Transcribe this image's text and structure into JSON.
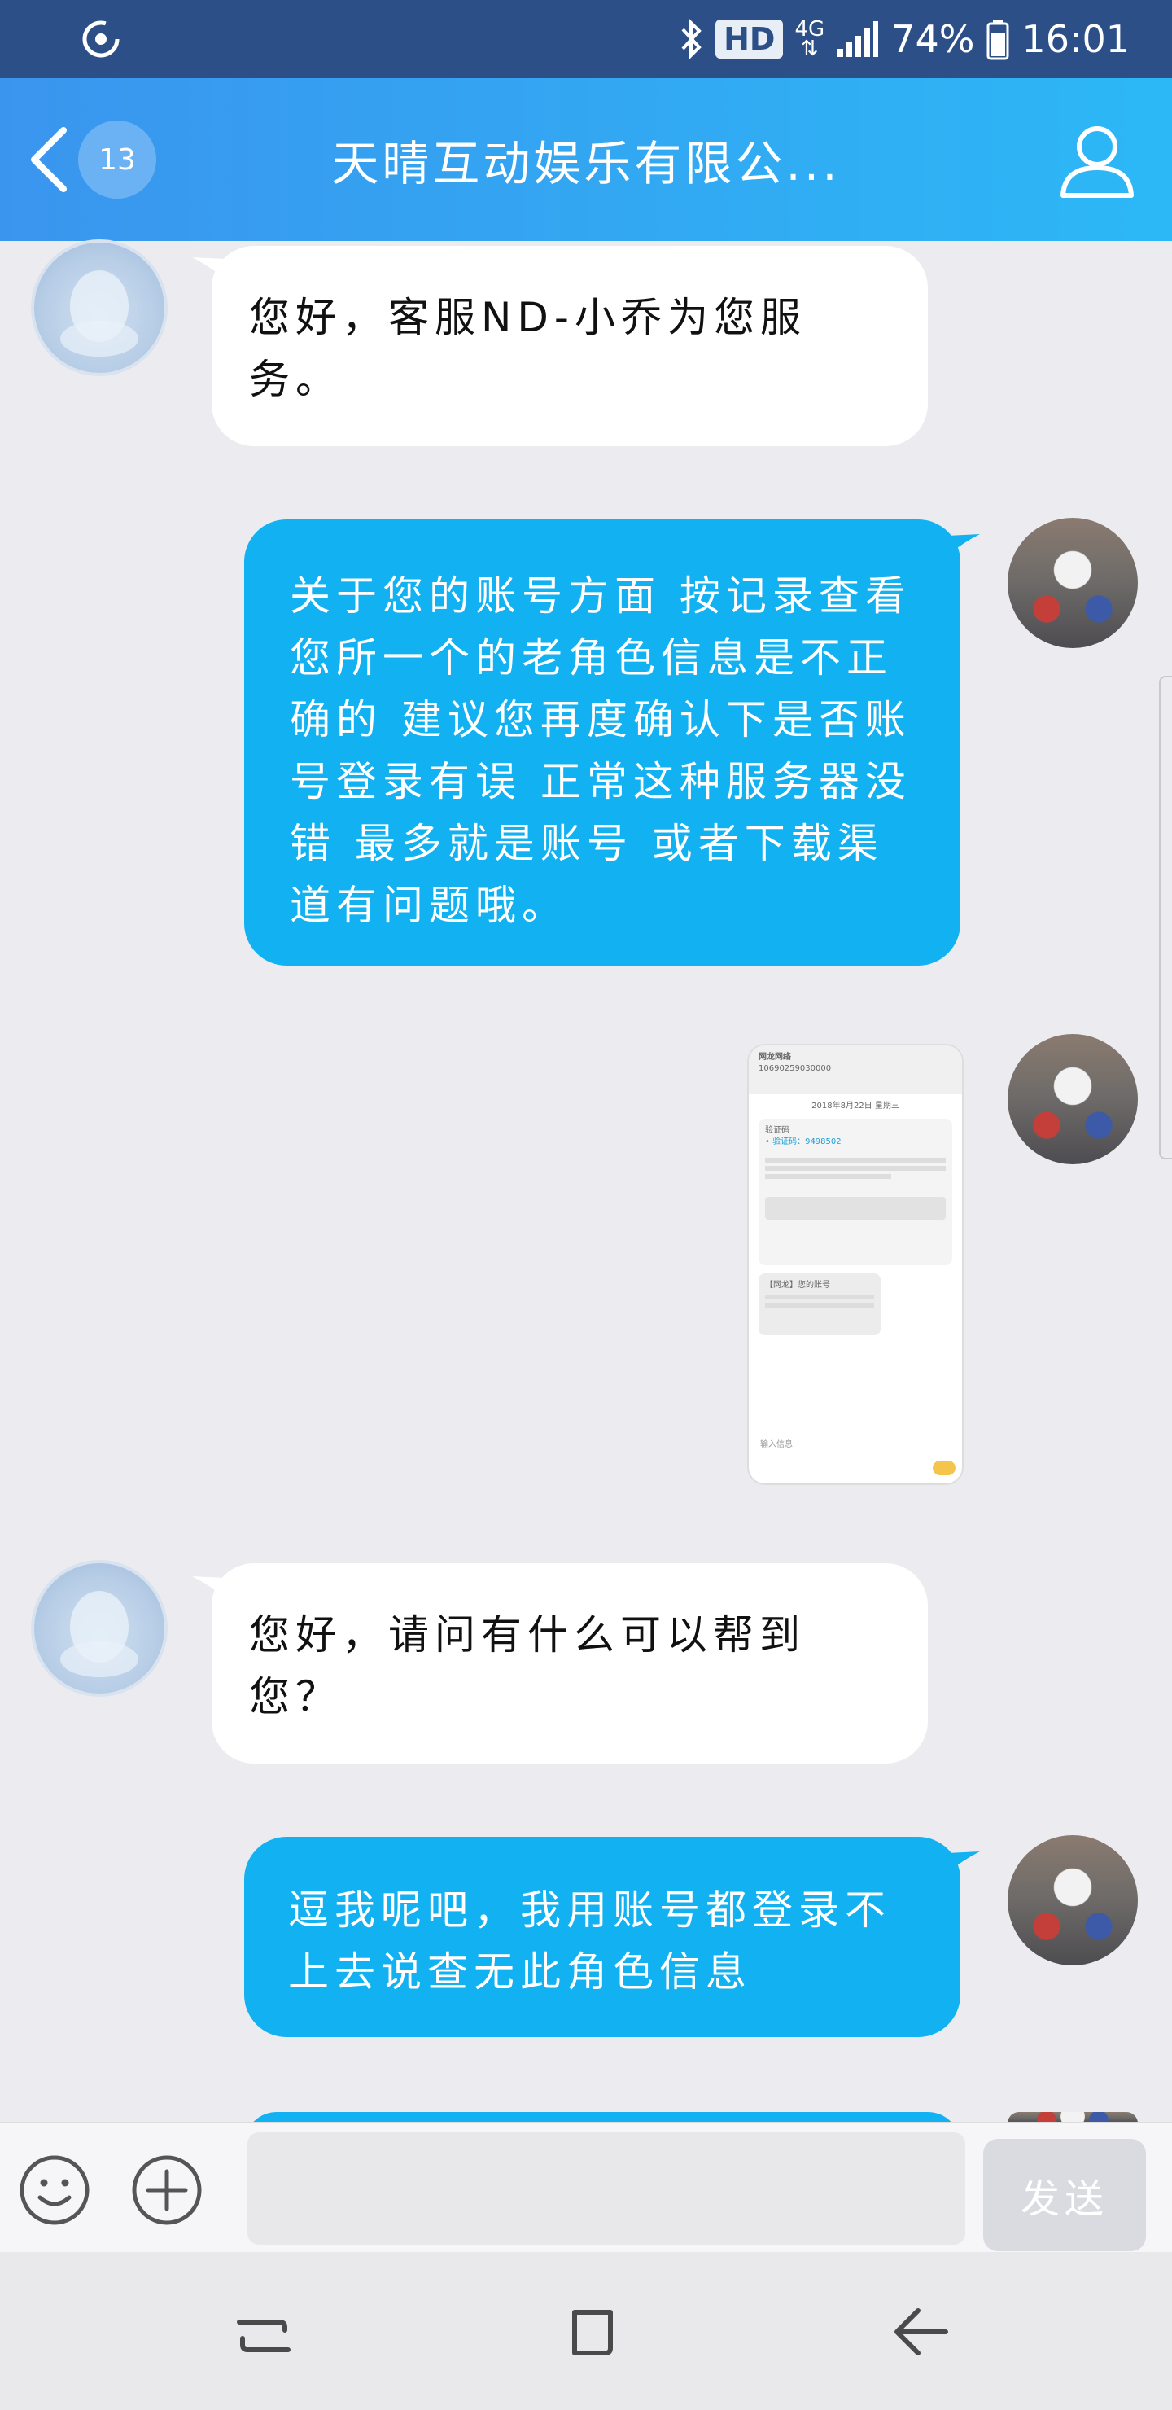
{
  "status_bar": {
    "hd": "HD",
    "network": "4G",
    "battery": "74%",
    "time": "16:01"
  },
  "header": {
    "unread_count": "13",
    "title": "天晴互动娱乐有限公..."
  },
  "messages": [
    {
      "from": "service",
      "text": "您好，客服ND-小乔为您服务。"
    },
    {
      "from": "user",
      "text": "关于您的账号方面 按记录查看您所一个的老角色信息是不正确的  建议您再度确认下是否账号登录有误 正常这种服务器没错 最多就是账号 或者下载渠道有问题哦。"
    },
    {
      "from": "user",
      "type": "image",
      "image_lines": [
        "网龙网络",
        "10690259030000",
        "2018年8月22日 星期三",
        "验证码",
        "• 验证码：9498502",
        "【网龙】您的账号",
        "输入信息"
      ]
    },
    {
      "from": "service",
      "text": "您好，请问有什么可以帮到您？"
    },
    {
      "from": "user",
      "text": "逗我呢吧，我用账号都登录不上去说查无此角色信息"
    }
  ],
  "input_bar": {
    "placeholder": "",
    "send_label": "发送"
  },
  "colors": {
    "status_bar": "#2b4f86",
    "header_start": "#3a95ee",
    "header_end": "#2cb8f6",
    "outgoing_bubble": "#12b1f2",
    "incoming_bubble": "#ffffff",
    "background": "#ececf0"
  },
  "icons": [
    "sync-icon",
    "bluetooth-icon",
    "signal-icon",
    "battery-icon",
    "back-arrow-icon",
    "profile-icon",
    "emoji-icon",
    "plus-icon",
    "recent-apps-icon",
    "home-icon",
    "back-nav-icon"
  ]
}
